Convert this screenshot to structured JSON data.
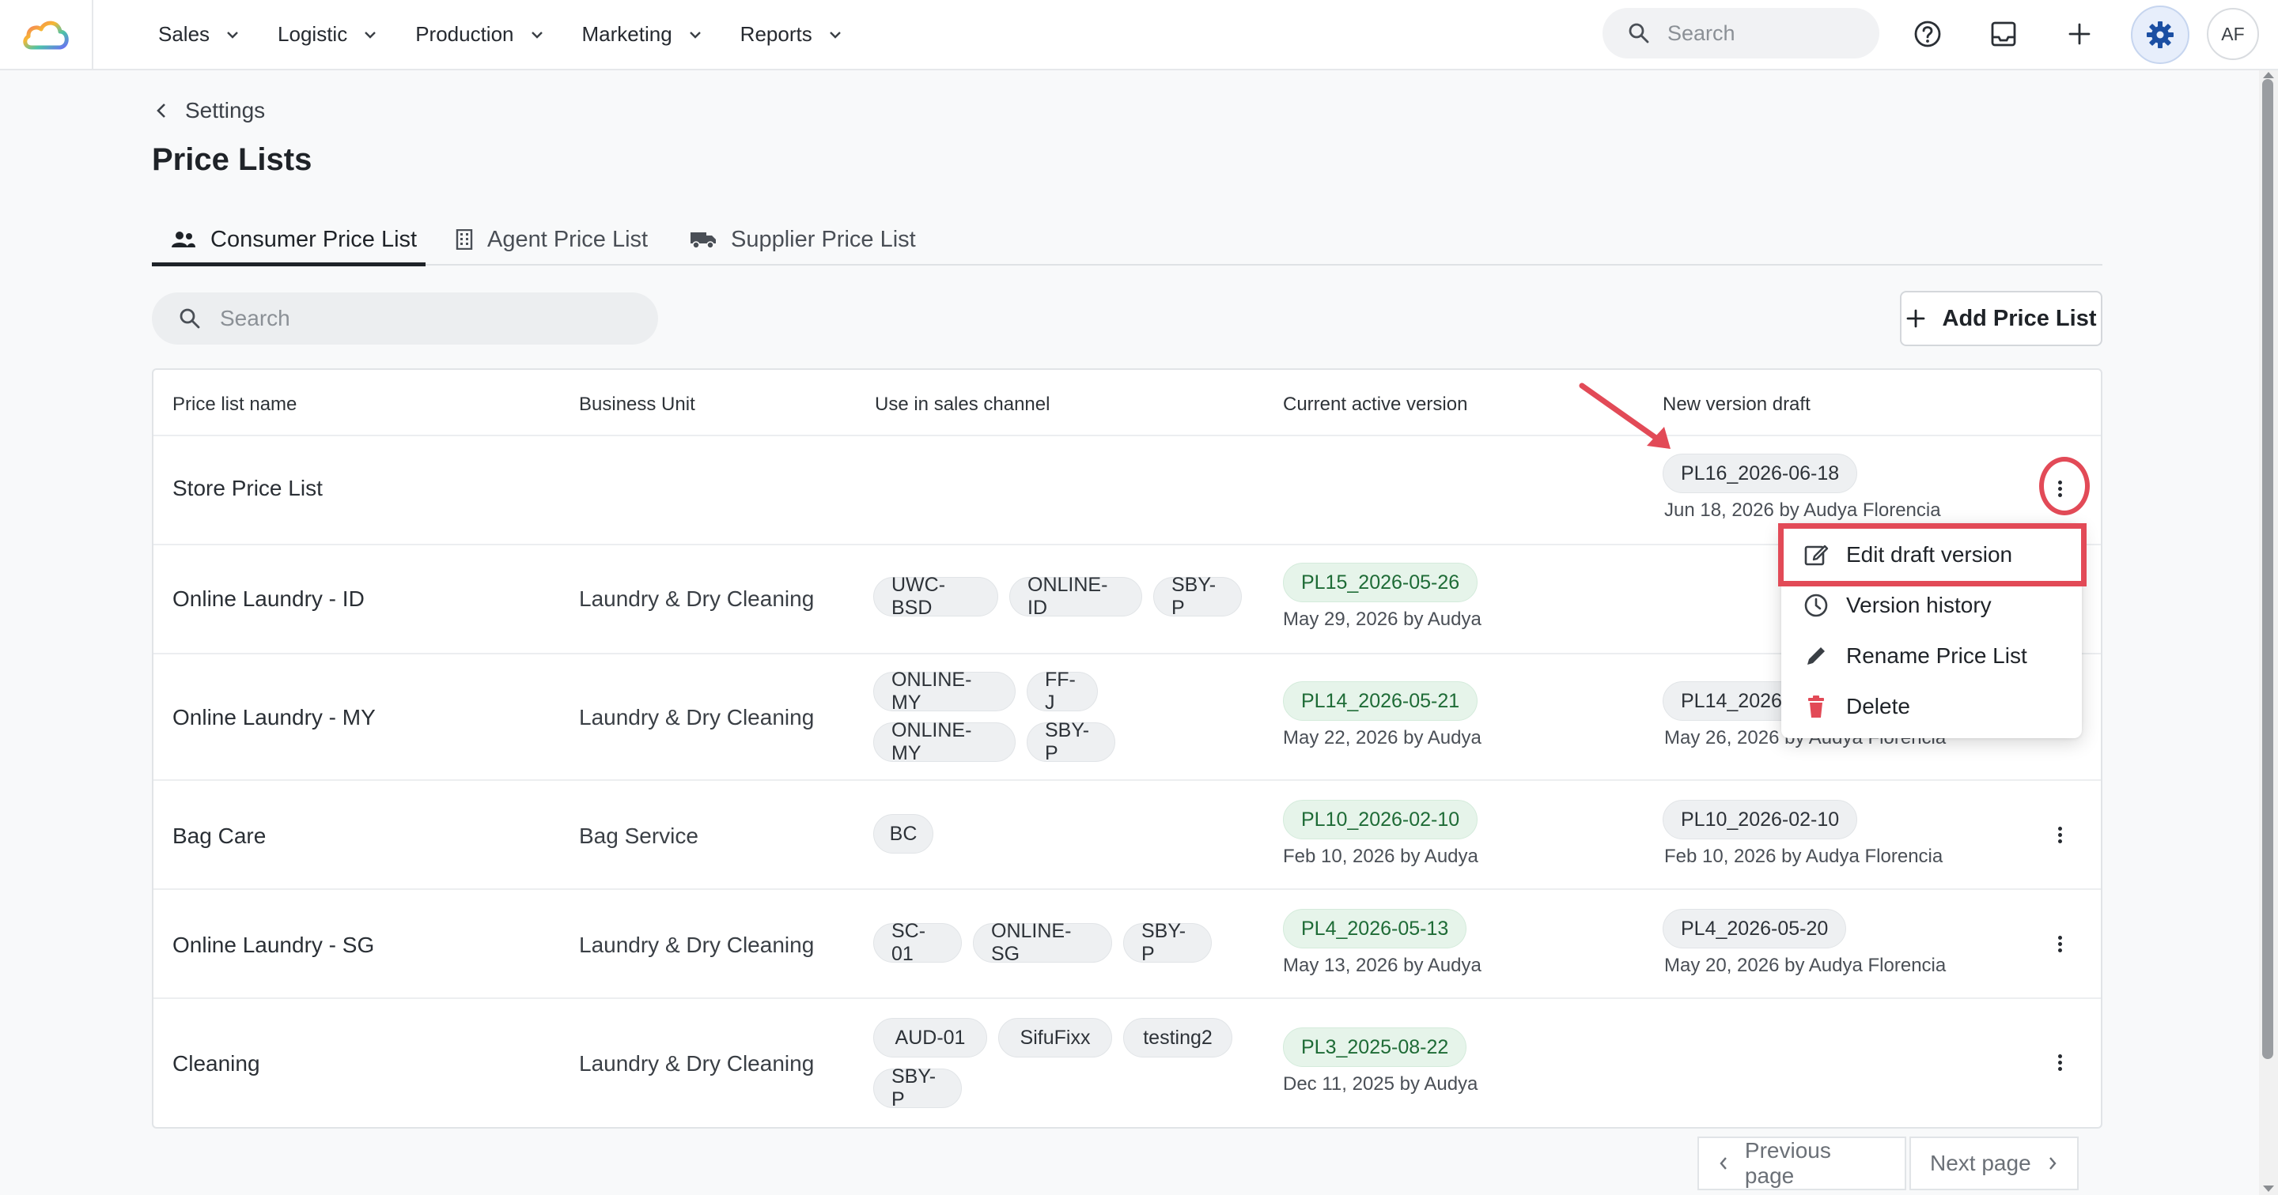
{
  "nav": {
    "items": [
      {
        "label": "Sales"
      },
      {
        "label": "Logistic"
      },
      {
        "label": "Production"
      },
      {
        "label": "Marketing"
      },
      {
        "label": "Reports"
      }
    ],
    "search_placeholder": "Search",
    "avatar_initials": "AF"
  },
  "breadcrumb": {
    "label": "Settings"
  },
  "page": {
    "title": "Price Lists"
  },
  "tabs": [
    {
      "label": "Consumer Price List",
      "active": true,
      "icon": "users-icon"
    },
    {
      "label": "Agent Price List",
      "active": false,
      "icon": "building-icon"
    },
    {
      "label": "Supplier Price List",
      "active": false,
      "icon": "truck-icon"
    }
  ],
  "list": {
    "search_placeholder": "Search",
    "add_button_label": "Add Price List"
  },
  "table": {
    "headers": [
      "Price list name",
      "Business Unit",
      "Use in sales channel",
      "Current active version",
      "New version draft"
    ],
    "rows": [
      {
        "name": "Store Price List",
        "business_unit": "",
        "channels": [],
        "active_version": "",
        "active_sub": "",
        "draft_version": "PL16_2026-06-18",
        "draft_sub": "Jun 18, 2026 by Audya Florencia"
      },
      {
        "name": "Online Laundry - ID",
        "business_unit": "Laundry & Dry Cleaning",
        "channels": [
          "UWC-BSD",
          "ONLINE-ID",
          "SBY-P"
        ],
        "active_version": "PL15_2026-05-26",
        "active_sub": "May 29, 2026 by Audya",
        "draft_version": "",
        "draft_sub": ""
      },
      {
        "name": "Online Laundry - MY",
        "business_unit": "Laundry & Dry Cleaning",
        "channels": [
          "ONLINE-MY",
          "FF-J",
          "ONLINE-MY",
          "SBY-P"
        ],
        "active_version": "PL14_2026-05-21",
        "active_sub": "May 22, 2026 by Audya",
        "draft_version": "PL14_2026-",
        "draft_sub": "May 26, 2026 by Audya Florencia"
      },
      {
        "name": "Bag Care",
        "business_unit": "Bag Service",
        "channels": [
          "BC"
        ],
        "active_version": "PL10_2026-02-10",
        "active_sub": "Feb 10, 2026 by Audya",
        "draft_version": "PL10_2026-02-10",
        "draft_sub": "Feb 10, 2026 by Audya Florencia"
      },
      {
        "name": "Online Laundry - SG",
        "business_unit": "Laundry & Dry Cleaning",
        "channels": [
          "SC-01",
          "ONLINE-SG",
          "SBY-P"
        ],
        "active_version": "PL4_2026-05-13",
        "active_sub": "May 13, 2026 by Audya",
        "draft_version": "PL4_2026-05-20",
        "draft_sub": "May 20, 2026 by Audya Florencia"
      },
      {
        "name": "Cleaning",
        "business_unit": "Laundry & Dry Cleaning",
        "channels": [
          "AUD-01",
          "SifuFixx",
          "testing2",
          "SBY-P"
        ],
        "active_version": "PL3_2025-08-22",
        "active_sub": "Dec 11, 2025 by Audya",
        "draft_version": "",
        "draft_sub": ""
      }
    ]
  },
  "row_menu": {
    "items": [
      {
        "label": "Edit draft version",
        "icon": "edit-icon"
      },
      {
        "label": "Version history",
        "icon": "clock-icon"
      },
      {
        "label": "Rename Price List",
        "icon": "pencil-icon"
      },
      {
        "label": "Delete",
        "icon": "trash-icon"
      }
    ]
  },
  "pagination": {
    "previous_label": "Previous page",
    "next_label": "Next page"
  },
  "colors": {
    "accent_annotation": "#e24a57",
    "active_chip_bg": "#e6f4ea",
    "active_chip_text": "#1e6b36",
    "delete_icon": "#e24a57"
  }
}
